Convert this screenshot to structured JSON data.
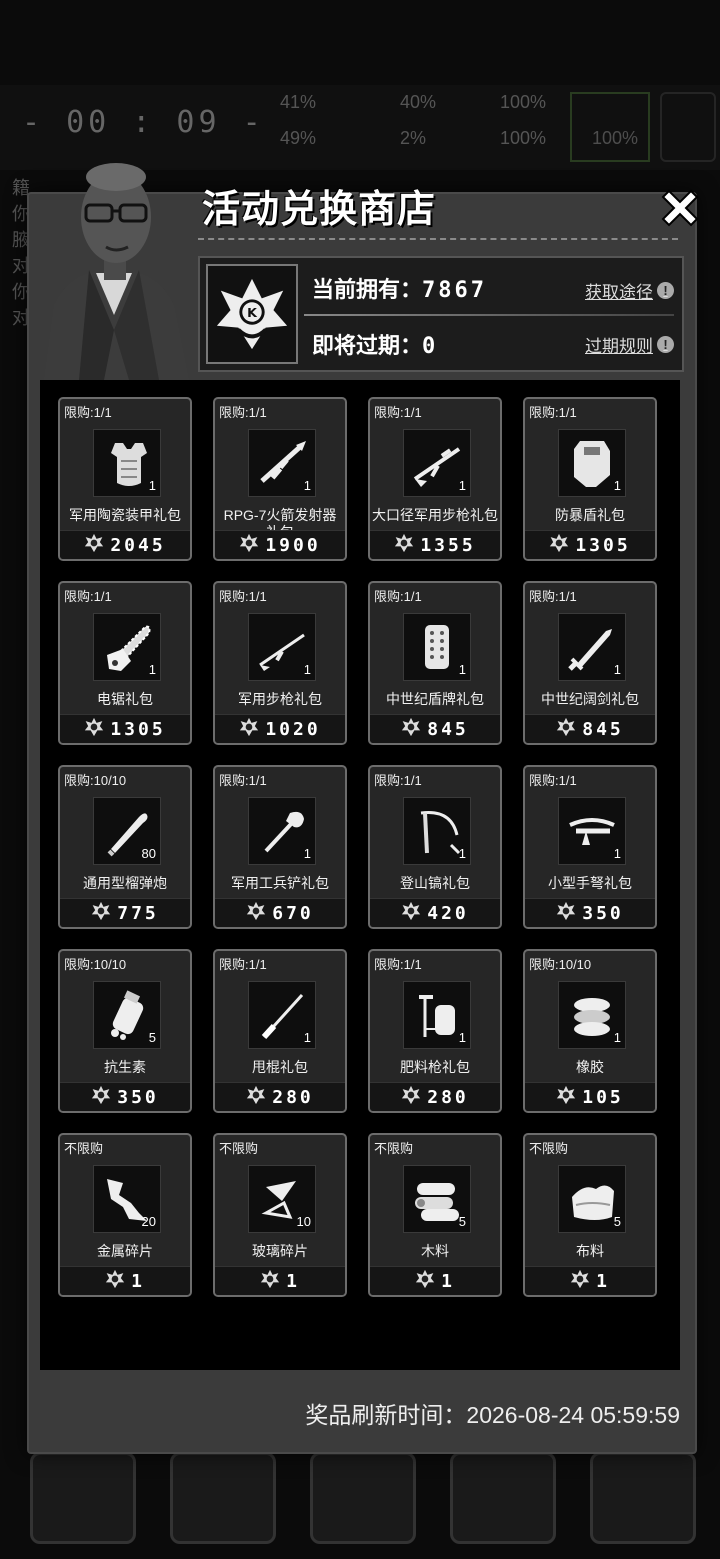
{
  "hud": {
    "timer": "- 00 : 09 -",
    "stats": [
      "41%",
      "40%",
      "100%",
      "49%",
      "2%",
      "100%",
      "100%"
    ],
    "side_text": [
      "籍",
      "你",
      "腋",
      "对",
      "你",
      "对"
    ]
  },
  "shop": {
    "title": "活动兑换商店",
    "owned_label": "当前拥有：",
    "owned_value": "7867",
    "expiring_label": "即将过期：",
    "expiring_value": "0",
    "obtain_link": "获取途径",
    "expiry_rule_link": "过期规则",
    "refresh_label": "奖品刷新时间：",
    "refresh_time": "2026-08-24 05:59:59",
    "items": [
      {
        "limit": "限购:1/1",
        "name": "军用陶瓷装甲礼包",
        "qty": "1",
        "price": "2045",
        "icon": "armor-vest-icon"
      },
      {
        "limit": "限购:1/1",
        "name": "RPG-7火箭发射器礼包",
        "qty": "1",
        "price": "1900",
        "icon": "rocket-launcher-icon"
      },
      {
        "limit": "限购:1/1",
        "name": "大口径军用步枪礼包",
        "qty": "1",
        "price": "1355",
        "icon": "heavy-rifle-icon"
      },
      {
        "limit": "限购:1/1",
        "name": "防暴盾礼包",
        "qty": "1",
        "price": "1305",
        "icon": "riot-shield-icon"
      },
      {
        "limit": "限购:1/1",
        "name": "电锯礼包",
        "qty": "1",
        "price": "1305",
        "icon": "chainsaw-icon"
      },
      {
        "limit": "限购:1/1",
        "name": "军用步枪礼包",
        "qty": "1",
        "price": "1020",
        "icon": "rifle-icon"
      },
      {
        "limit": "限购:1/1",
        "name": "中世纪盾牌礼包",
        "qty": "1",
        "price": "845",
        "icon": "medieval-shield-icon"
      },
      {
        "limit": "限购:1/1",
        "name": "中世纪阔剑礼包",
        "qty": "1",
        "price": "845",
        "icon": "broadsword-icon"
      },
      {
        "limit": "限购:10/10",
        "name": "通用型榴弹炮",
        "qty": "80",
        "price": "775",
        "icon": "grenade-shell-icon"
      },
      {
        "limit": "限购:1/1",
        "name": "军用工兵铲礼包",
        "qty": "1",
        "price": "670",
        "icon": "shovel-icon"
      },
      {
        "limit": "限购:1/1",
        "name": "登山镐礼包",
        "qty": "1",
        "price": "420",
        "icon": "ice-axe-icon"
      },
      {
        "limit": "限购:1/1",
        "name": "小型手弩礼包",
        "qty": "1",
        "price": "350",
        "icon": "crossbow-icon"
      },
      {
        "limit": "限购:10/10",
        "name": "抗生素",
        "qty": "5",
        "price": "350",
        "icon": "antibiotic-icon"
      },
      {
        "limit": "限购:1/1",
        "name": "甩棍礼包",
        "qty": "1",
        "price": "280",
        "icon": "baton-icon"
      },
      {
        "limit": "限购:1/1",
        "name": "肥料枪礼包",
        "qty": "1",
        "price": "280",
        "icon": "fertilizer-gun-icon"
      },
      {
        "limit": "限购:10/10",
        "name": "橡胶",
        "qty": "1",
        "price": "105",
        "icon": "rubber-icon"
      },
      {
        "limit": "不限购",
        "name": "金属碎片",
        "qty": "20",
        "price": "1",
        "icon": "metal-scrap-icon"
      },
      {
        "limit": "不限购",
        "name": "玻璃碎片",
        "qty": "10",
        "price": "1",
        "icon": "glass-shard-icon"
      },
      {
        "limit": "不限购",
        "name": "木料",
        "qty": "5",
        "price": "1",
        "icon": "wood-logs-icon"
      },
      {
        "limit": "不限购",
        "name": "布料",
        "qty": "5",
        "price": "1",
        "icon": "cloth-icon"
      }
    ]
  }
}
